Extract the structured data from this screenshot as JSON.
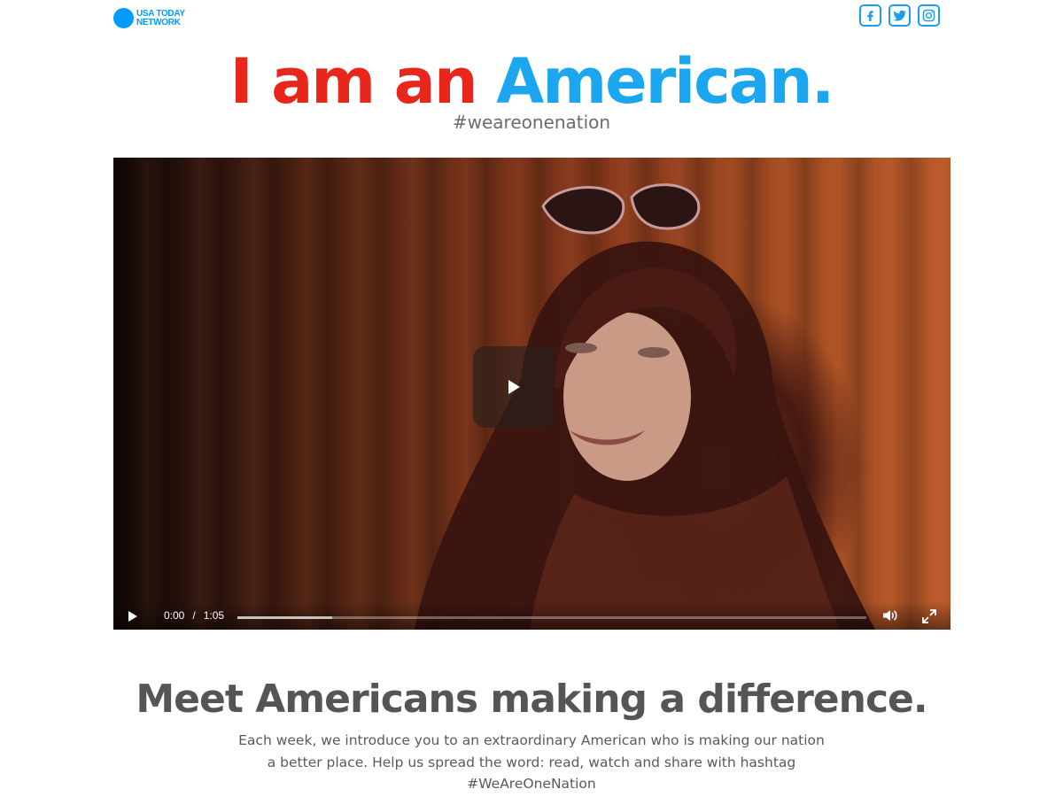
{
  "header": {
    "logo_line1": "USA TODAY",
    "logo_line2": "NETWORK",
    "social": [
      "facebook-icon",
      "twitter-icon",
      "instagram-icon"
    ]
  },
  "hero": {
    "title_part1": "I am an",
    "title_part2": "American.",
    "hashtag": "#weareonenation"
  },
  "video": {
    "current_time": "0:00",
    "separator": "/",
    "duration": "1:05",
    "buffered_fraction": 0.15
  },
  "section": {
    "title": "Meet Americans making a difference.",
    "body_line1": "Each week, we introduce you to an extraordinary American who is making our nation",
    "body_line2": "a better place. Help us spread the word: read, watch and share with hashtag",
    "body_line3": "#WeAreOneNation"
  },
  "colors": {
    "red": "#e8261b",
    "blue": "#1ba6ef",
    "logo_blue": "#009bff"
  }
}
